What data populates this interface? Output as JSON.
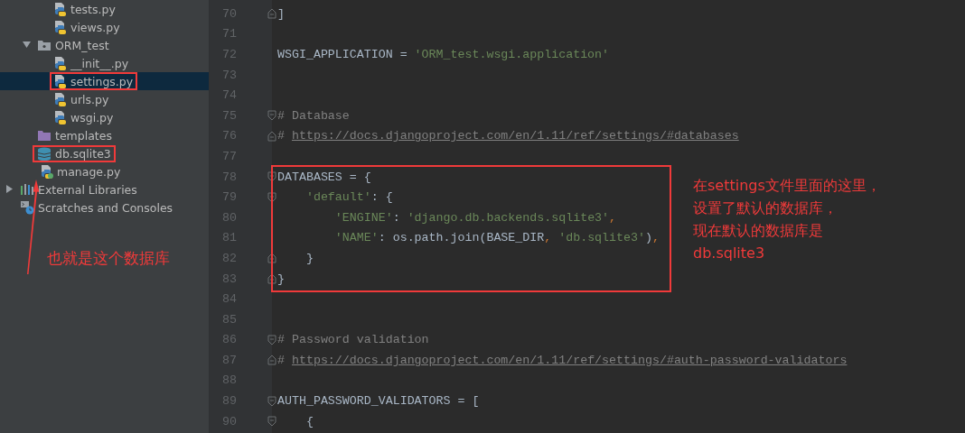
{
  "project_tree": [
    {
      "children": [
        {
          "children": [
            {
              "label": "tests.py",
              "kind": "python",
              "selected": false,
              "highlighted": false
            },
            {
              "label": "views.py",
              "kind": "python",
              "selected": false,
              "highlighted": false
            }
          ]
        },
        {
          "label": "ORM_test",
          "kind": "package",
          "expanded": true,
          "selected": false,
          "highlighted": false,
          "children": [
            {
              "label": "__init__.py",
              "kind": "python",
              "selected": false,
              "highlighted": false
            },
            {
              "label": "settings.py",
              "kind": "python",
              "selected": true,
              "highlighted": true
            },
            {
              "label": "urls.py",
              "kind": "python",
              "selected": false,
              "highlighted": false
            },
            {
              "label": "wsgi.py",
              "kind": "python",
              "selected": false,
              "highlighted": false
            }
          ]
        },
        {
          "label": "templates",
          "kind": "folder",
          "selected": false,
          "highlighted": false
        },
        {
          "label": "db.sqlite3",
          "kind": "database",
          "selected": false,
          "highlighted": true
        },
        {
          "label": "manage.py",
          "kind": "python-run",
          "selected": false,
          "highlighted": false
        }
      ]
    },
    {
      "label": "External Libraries",
      "kind": "libraries",
      "expanded": false,
      "selected": false,
      "highlighted": false
    },
    {
      "label": "Scratches and Consoles",
      "kind": "scratches",
      "selected": false,
      "highlighted": false
    }
  ],
  "editor": {
    "blocks": [
      {
        "boxed": false,
        "lines": [
          {
            "number": "70",
            "kind": "fold-end",
            "tokens": [
              {
                "text": "]",
                "kind": "text"
              }
            ]
          },
          {
            "number": "71",
            "kind": "plain"
          },
          {
            "number": "72",
            "kind": "plain",
            "tokens": [
              {
                "text": "WSGI_APPLICATION = ",
                "kind": "text"
              },
              {
                "text": "'ORM_test.wsgi.application'",
                "kind": "string"
              }
            ]
          },
          {
            "number": "73",
            "kind": "plain"
          },
          {
            "number": "74",
            "kind": "plain"
          },
          {
            "number": "75",
            "kind": "fold-start",
            "tokens": [
              {
                "text": "# Database",
                "kind": "comment"
              }
            ]
          },
          {
            "number": "76",
            "kind": "fold-end",
            "tokens": [
              {
                "text": "# ",
                "kind": "comment"
              },
              {
                "text": "https://docs.djangoproject.com/en/1.11/ref/settings/#databases",
                "kind": "link"
              }
            ]
          },
          {
            "number": "77",
            "kind": "plain"
          }
        ]
      },
      {
        "boxed": true,
        "lines": [
          {
            "number": "78",
            "kind": "fold-start",
            "tokens": [
              {
                "text": "DATABASES = {",
                "kind": "text"
              }
            ]
          },
          {
            "number": "79",
            "kind": "fold-start",
            "tokens": [
              {
                "text": "    'default'",
                "kind": "string"
              },
              {
                "text": ": {",
                "kind": "text"
              }
            ]
          },
          {
            "number": "80",
            "kind": "plain",
            "tokens": [
              {
                "text": "        'ENGINE'",
                "kind": "string"
              },
              {
                "text": ": ",
                "kind": "text"
              },
              {
                "text": "'django.db.backends.sqlite3'",
                "kind": "string"
              },
              {
                "text": ",",
                "kind": "punct"
              }
            ]
          },
          {
            "number": "81",
            "kind": "plain",
            "tokens": [
              {
                "text": "        'NAME'",
                "kind": "string"
              },
              {
                "text": ": os.path.join(BASE_DIR",
                "kind": "text"
              },
              {
                "text": ", ",
                "kind": "punct"
              },
              {
                "text": "'db.sqlite3'",
                "kind": "string"
              },
              {
                "text": ")",
                "kind": "text"
              },
              {
                "text": ",",
                "kind": "punct"
              }
            ]
          },
          {
            "number": "82",
            "kind": "fold-end",
            "tokens": [
              {
                "text": "    }",
                "kind": "text"
              }
            ]
          },
          {
            "number": "83",
            "kind": "fold-end",
            "tokens": [
              {
                "text": "}",
                "kind": "text"
              }
            ]
          }
        ]
      },
      {
        "boxed": false,
        "lines": [
          {
            "number": "84",
            "kind": "plain"
          },
          {
            "number": "85",
            "kind": "plain"
          },
          {
            "number": "86",
            "kind": "fold-start",
            "tokens": [
              {
                "text": "# Password validation",
                "kind": "comment"
              }
            ]
          },
          {
            "number": "87",
            "kind": "fold-end",
            "tokens": [
              {
                "text": "# ",
                "kind": "comment"
              },
              {
                "text": "https://docs.djangoproject.com/en/1.11/ref/settings/#auth-password-validators",
                "kind": "link"
              }
            ]
          },
          {
            "number": "88",
            "kind": "plain"
          },
          {
            "number": "89",
            "kind": "fold-start",
            "tokens": [
              {
                "text": "AUTH_PASSWORD_VALIDATORS = [",
                "kind": "text"
              }
            ]
          },
          {
            "number": "90",
            "kind": "fold-start",
            "tokens": [
              {
                "text": "    {",
                "kind": "text"
              }
            ]
          }
        ]
      }
    ]
  },
  "annotations": [
    {
      "kind": "arrow-note",
      "lines": [
        "也就是这个数据库"
      ]
    },
    {
      "kind": "side-note",
      "lines": [
        "在settings文件里面的这里，",
        "设置了默认的数据库，",
        "现在默认的数据库是",
        "db.sqlite3"
      ]
    }
  ]
}
